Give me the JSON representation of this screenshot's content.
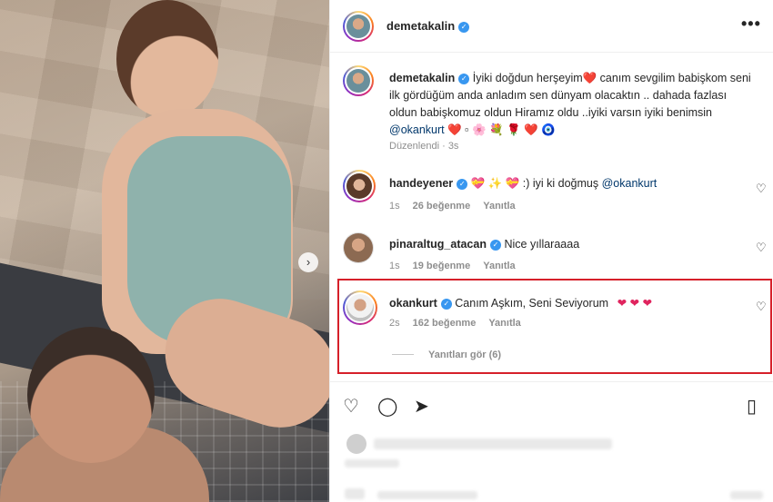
{
  "post_author": {
    "username": "demetakalin",
    "more_icon": "more-options-icon",
    "more_label": "•••"
  },
  "caption": {
    "username": "demetakalin",
    "text": "İyiki doğdun herşeyim❤️ canım sevgilim babişkom seni ilk gördüğüm anda anladım sen dünyam olacaktın .. dahada fazlası oldun babişkomuz oldun Hiramız oldu ..iyiki varsın iyiki benimsin",
    "mention": "@okankurt",
    "emojis": "❤️ ▫ 🌸 💐 🌹 ❤️ 🧿",
    "meta": "Düzenlendi · 3s"
  },
  "comments": [
    {
      "username": "handeyener",
      "verified": true,
      "text": "💝 ✨ 💝 :) iyi ki doğmuş",
      "mention": "@okankurt",
      "time": "1s",
      "likes": "26 beğenme",
      "reply": "Yanıtla"
    },
    {
      "username": "pinaraltug_atacan",
      "verified": true,
      "text": "Nice yıllaraaaa",
      "mention": "",
      "time": "1s",
      "likes": "19 beğenme",
      "reply": "Yanıtla"
    },
    {
      "username": "okankurt",
      "verified": true,
      "text": "Canım Aşkım, Seni Seviyorum",
      "hearts": "❤ ❤ ❤",
      "time": "2s",
      "likes": "162 beğenme",
      "reply": "Yanıtla",
      "view_replies": "Yanıtları gör (6)"
    }
  ],
  "actions": {
    "like_icon": "heart-icon",
    "comment_icon": "comment-icon",
    "share_icon": "share-icon",
    "save_icon": "bookmark-icon"
  },
  "colors": {
    "verified": "#3897f0",
    "heart": "#e0245e",
    "highlight": "#d6202a",
    "link": "#00376b"
  }
}
